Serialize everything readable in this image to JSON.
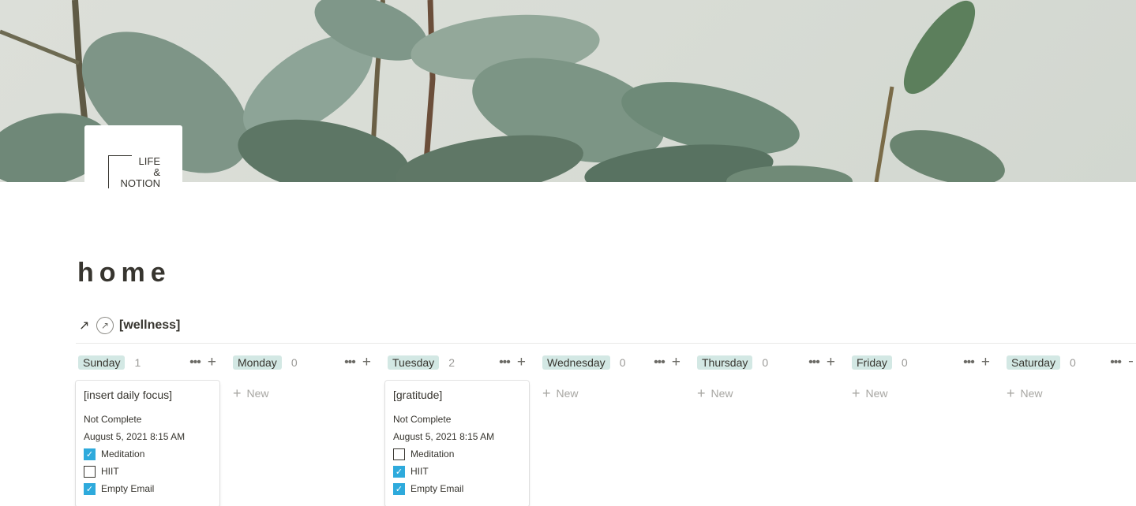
{
  "logo": {
    "lines": [
      "LIFE",
      "&",
      "NOTION"
    ]
  },
  "page": {
    "title": "home"
  },
  "database": {
    "link_icon": "↗",
    "icon": "arrow-circle-icon",
    "title": "[wellness]"
  },
  "board": {
    "new_label": "New",
    "columns": [
      {
        "day": "Sunday",
        "count": "1",
        "cards": [
          {
            "title": "[insert daily focus]",
            "status": "Not Complete",
            "date": "August 5, 2021 8:15 AM",
            "checks": [
              {
                "label": "Meditation",
                "checked": true
              },
              {
                "label": "HIIT",
                "checked": false
              },
              {
                "label": "Empty Email",
                "checked": true
              }
            ]
          }
        ]
      },
      {
        "day": "Monday",
        "count": "0",
        "cards": []
      },
      {
        "day": "Tuesday",
        "count": "2",
        "cards": [
          {
            "title": "[gratitude]",
            "status": "Not Complete",
            "date": "August 5, 2021 8:15 AM",
            "checks": [
              {
                "label": "Meditation",
                "checked": false
              },
              {
                "label": "HIIT",
                "checked": true
              },
              {
                "label": "Empty Email",
                "checked": true
              }
            ]
          }
        ]
      },
      {
        "day": "Wednesday",
        "count": "0",
        "cards": []
      },
      {
        "day": "Thursday",
        "count": "0",
        "cards": []
      },
      {
        "day": "Friday",
        "count": "0",
        "cards": []
      },
      {
        "day": "Saturday",
        "count": "0",
        "cards": []
      }
    ]
  },
  "colors": {
    "tag_bg": "#d3e8e4",
    "checkbox": "#2eaadc",
    "text": "#37352f"
  }
}
